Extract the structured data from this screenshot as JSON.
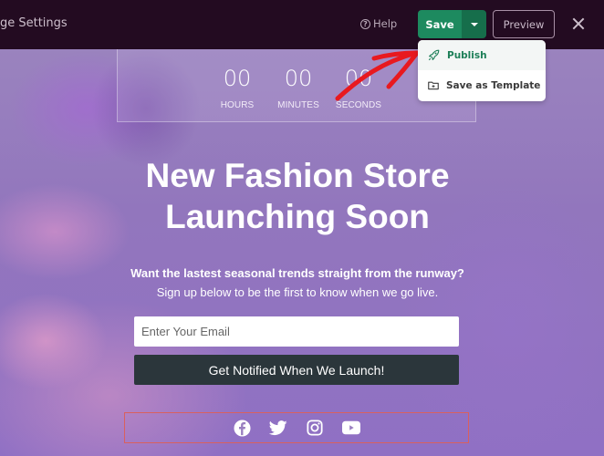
{
  "topbar": {
    "title": "age Settings",
    "help_label": "Help",
    "save_label": "Save",
    "preview_label": "Preview",
    "icons": {
      "help": "question-circle-icon",
      "save_caret": "caret-down-icon",
      "close": "close-icon"
    }
  },
  "save_menu": {
    "items": [
      {
        "label": "Publish",
        "icon": "rocket-icon"
      },
      {
        "label": "Save as Template",
        "icon": "folder-icon"
      }
    ]
  },
  "countdown": {
    "units": [
      {
        "value": "00",
        "label": "HOURS"
      },
      {
        "value": "00",
        "label": "MINUTES"
      },
      {
        "value": "00",
        "label": "SECONDS"
      }
    ]
  },
  "hero": {
    "headline_line1": "New Fashion Store",
    "headline_line2": "Launching Soon",
    "subheadline": "Want the lastest seasonal trends straight from the runway?",
    "description": "Sign up below to be the first to know when we go live.",
    "email_placeholder": "Enter Your Email",
    "email_value": "",
    "cta_label": "Get Notified When We Launch!"
  },
  "social": {
    "icons": [
      "facebook-icon",
      "twitter-icon",
      "instagram-icon",
      "youtube-icon"
    ]
  },
  "colors": {
    "topbar_bg": "#230b21",
    "save_green": "#1d8a5f",
    "save_caret_green": "#166e4b",
    "publish_text": "#1d7f58",
    "cta_bg": "#2b363b",
    "hero_purple": "#9276bd",
    "annotation_red": "#e8191f",
    "social_border": "#d9605e"
  }
}
